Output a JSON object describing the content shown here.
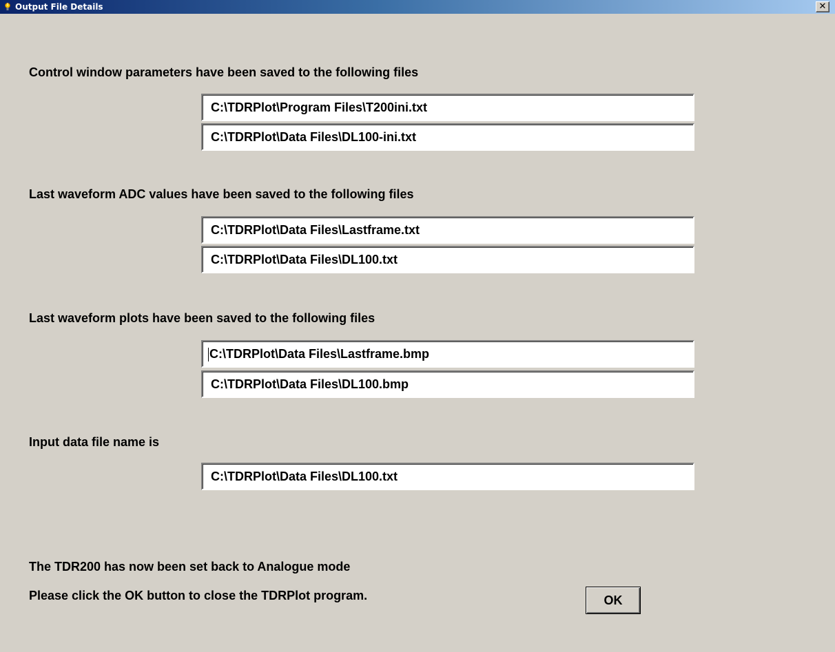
{
  "window": {
    "title": "Output File Details",
    "close_label": "✕"
  },
  "sections": {
    "control": {
      "label": "Control window parameters have been saved to the following files",
      "files": [
        "C:\\TDRPlot\\Program Files\\T200ini.txt",
        "C:\\TDRPlot\\Data Files\\DL100-ini.txt"
      ]
    },
    "adc": {
      "label": "Last waveform ADC values have been saved to the following files",
      "files": [
        "C:\\TDRPlot\\Data Files\\Lastframe.txt",
        "C:\\TDRPlot\\Data Files\\DL100.txt"
      ]
    },
    "plots": {
      "label": "Last waveform plots have been saved to the following files",
      "files": [
        "C:\\TDRPlot\\Data Files\\Lastframe.bmp",
        "C:\\TDRPlot\\Data Files\\DL100.bmp"
      ]
    },
    "input": {
      "label": "Input data file name is",
      "file": "C:\\TDRPlot\\Data Files\\DL100.txt"
    }
  },
  "footer": {
    "status": "The TDR200 has now been set back to Analogue mode",
    "instruction": "Please click the OK button to close the TDRPlot program.",
    "ok_label": "OK"
  }
}
